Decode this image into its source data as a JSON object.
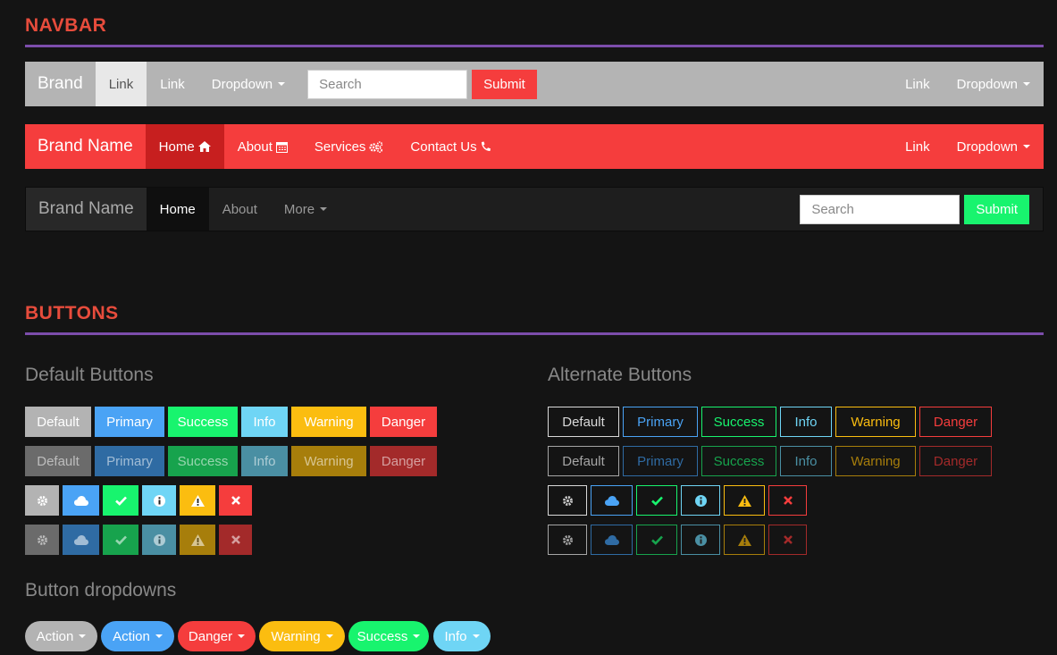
{
  "navbar_section": {
    "title": "NAVBAR"
  },
  "buttons_section": {
    "title": "BUTTONS"
  },
  "nav1": {
    "brand": "Brand",
    "link_active": "Link",
    "link": "Link",
    "dropdown": "Dropdown",
    "search_placeholder": "Search",
    "submit": "Submit",
    "right_link": "Link",
    "right_dropdown": "Dropdown"
  },
  "nav2": {
    "brand": "Brand Name",
    "home": "Home",
    "about": "About",
    "services": "Services",
    "contact": "Contact Us",
    "right_link": "Link",
    "right_dropdown": "Dropdown",
    "icons": {
      "home": "home-icon",
      "about": "calendar-icon",
      "services": "cogs-icon",
      "contact": "phone-icon"
    }
  },
  "nav3": {
    "brand": "Brand Name",
    "home": "Home",
    "about": "About",
    "more": "More",
    "search_placeholder": "Search",
    "submit": "Submit"
  },
  "default_buttons": {
    "heading": "Default Buttons",
    "labels": [
      "Default",
      "Primary",
      "Success",
      "Info",
      "Warning",
      "Danger"
    ],
    "colors": [
      "#b3b3b3",
      "#4aa3f5",
      "#18f46e",
      "#6fd5f5",
      "#fbbd10",
      "#f53d3d"
    ],
    "dark_colors": [
      "#6b6b6b",
      "#2f6ba3",
      "#17a34d",
      "#4a8fa3",
      "#a77e0b",
      "#a32a2a"
    ],
    "icons": [
      "gear-icon",
      "cloud-icon",
      "check-icon",
      "info-icon",
      "warning-icon",
      "close-icon"
    ]
  },
  "alternate_buttons": {
    "heading": "Alternate Buttons",
    "labels": [
      "Default",
      "Primary",
      "Success",
      "Info",
      "Warning",
      "Danger"
    ],
    "colors": [
      "#d9d9d9",
      "#4aa3f5",
      "#18f46e",
      "#6fd5f5",
      "#fbbd10",
      "#f53d3d"
    ],
    "dark_colors": [
      "#a6a6a6",
      "#2f6ba3",
      "#17a34d",
      "#4a8fa3",
      "#a77e0b",
      "#a32a2a"
    ]
  },
  "dropdown_buttons": {
    "heading": "Button dropdowns",
    "labels": [
      "Action",
      "Action",
      "Danger",
      "Warning",
      "Success",
      "Info"
    ],
    "colors": [
      "#b3b3b3",
      "#4aa3f5",
      "#f53d3d",
      "#fbbd10",
      "#18f46e",
      "#6fd5f5"
    ]
  }
}
